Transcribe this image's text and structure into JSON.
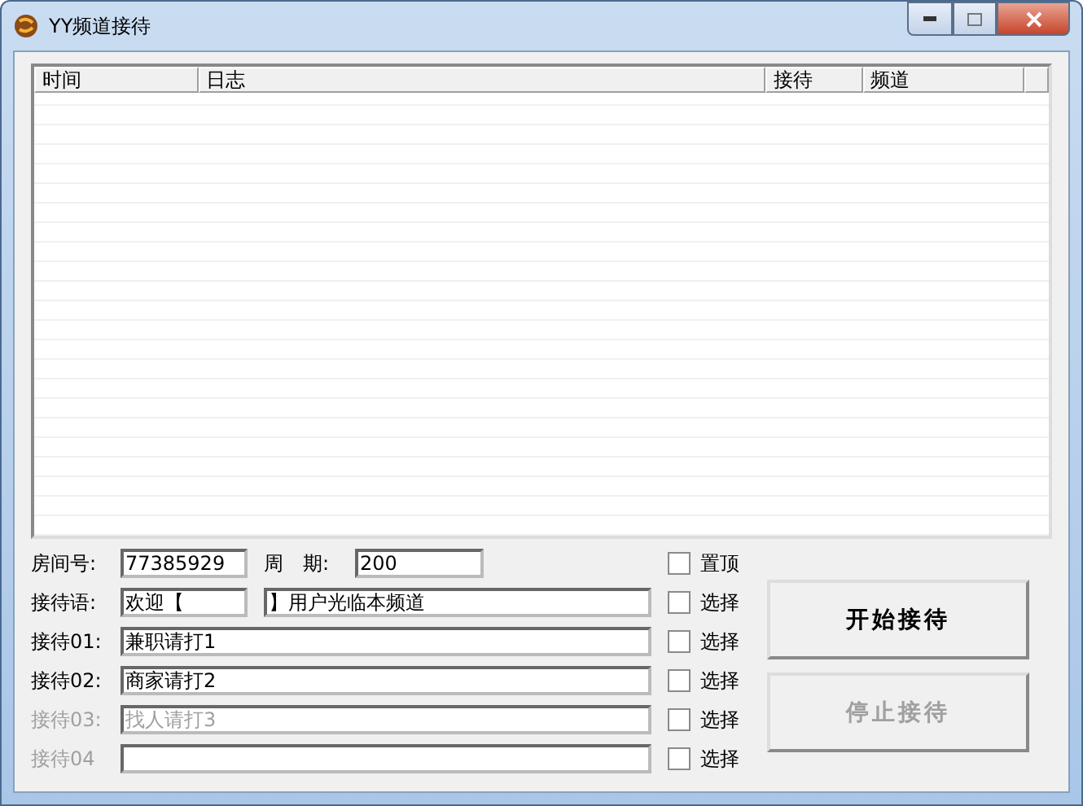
{
  "window": {
    "title": "YY频道接待"
  },
  "table": {
    "columns": [
      "时间",
      "日志",
      "接待",
      "频道"
    ]
  },
  "form": {
    "room_label": "房间号:",
    "room_value": "77385929",
    "period_label": "周　期:",
    "period_value": "200",
    "pin": {
      "label": "置顶",
      "checked": false
    },
    "greeting": {
      "label": "接待语:",
      "prefix": "欢迎【",
      "suffix": "】用户光临本频道",
      "select": {
        "label": "选择",
        "checked": false
      }
    },
    "rows": [
      {
        "label": "接待01:",
        "value": "兼职请打1",
        "disabled": false,
        "select": {
          "label": "选择",
          "checked": false
        }
      },
      {
        "label": "接待02:",
        "value": "商家请打2",
        "disabled": false,
        "select": {
          "label": "选择",
          "checked": false
        }
      },
      {
        "label": "接待03:",
        "value": "找人请打3",
        "disabled": true,
        "select": {
          "label": "选择",
          "checked": false
        }
      },
      {
        "label": "接待04",
        "value": "",
        "disabled": true,
        "select": {
          "label": "选择",
          "checked": false
        }
      }
    ]
  },
  "buttons": [
    {
      "label": "开始接待",
      "disabled": false
    },
    {
      "label": "停止接待",
      "disabled": true
    }
  ]
}
